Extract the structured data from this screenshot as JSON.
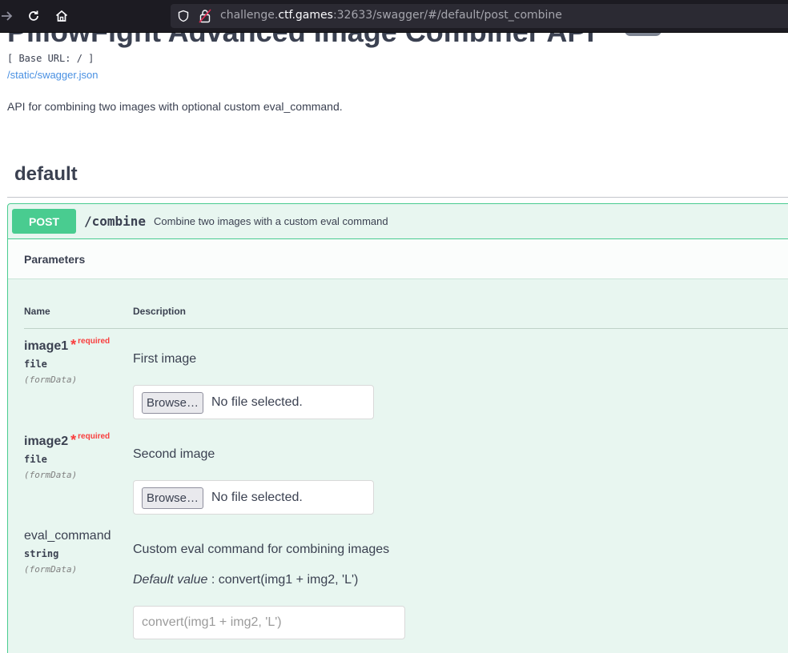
{
  "browser": {
    "url_prefix": "challenge.",
    "url_domain": "ctf.games",
    "url_suffix": ":32633/swagger/#/default/post_combine"
  },
  "api": {
    "title": "PillowFight Advanced Image Combiner API",
    "base_url": "[ Base URL: / ]",
    "spec_link": "/static/swagger.json",
    "description": "API for combining two images with optional custom eval_command."
  },
  "tag": {
    "name": "default"
  },
  "operation": {
    "method": "POST",
    "path": "/combine",
    "summary": "Combine two images with a custom eval command",
    "parameters_title": "Parameters",
    "columns": {
      "name": "Name",
      "description": "Description"
    },
    "params": [
      {
        "name": "image1",
        "required_star": "*",
        "required_label": "required",
        "type": "file",
        "in": "(formData)",
        "description": "First image",
        "browse_label": "Browse…",
        "file_status": "No file selected."
      },
      {
        "name": "image2",
        "required_star": "*",
        "required_label": "required",
        "type": "file",
        "in": "(formData)",
        "description": "Second image",
        "browse_label": "Browse…",
        "file_status": "No file selected."
      },
      {
        "name": "eval_command",
        "type": "string",
        "in": "(formData)",
        "description": "Custom eval command for combining images",
        "default_label": "Default value",
        "default_value": " : convert(img1 + img2, 'L')",
        "placeholder": "convert(img1 + img2, 'L')"
      }
    ]
  },
  "colors": {
    "post_green": "#49cc90",
    "opblock_bg": "#e8f6f0",
    "text": "#3b4151",
    "required_red": "#f93e3e",
    "link_blue": "#4990e2"
  }
}
